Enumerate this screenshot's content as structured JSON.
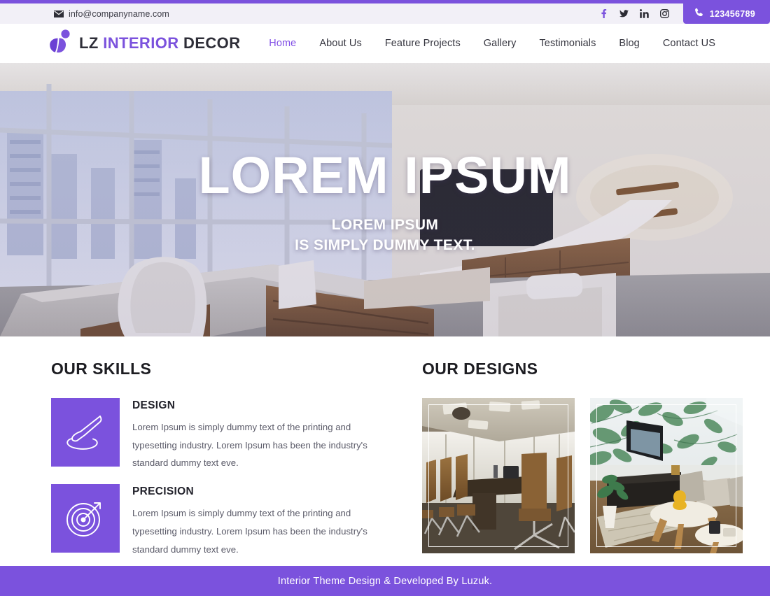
{
  "theme": {
    "accent": "#7b52dd",
    "accent_light": "#8250e6",
    "topbar_bg": "#f2f0f7",
    "dark_text": "#2e2e38"
  },
  "topbar": {
    "email": "info@companyname.com",
    "email_icon": "mail-icon",
    "socials": [
      {
        "name": "facebook-icon",
        "label": "f",
        "color": "#7b52dd"
      },
      {
        "name": "twitter-icon",
        "label": "t",
        "color": "#2b2b33"
      },
      {
        "name": "linkedin-icon",
        "label": "in",
        "color": "#2b2b33"
      },
      {
        "name": "instagram-icon",
        "label": "ig",
        "color": "#2b2b33"
      }
    ],
    "phone_icon": "phone-icon",
    "phone": "123456789"
  },
  "header": {
    "logo_icon": "leaf-person-logo-icon",
    "brand_part1": "LZ ",
    "brand_part2": "INTERIOR",
    "brand_part3": " DECOR",
    "nav": [
      {
        "label": "Home",
        "active": true
      },
      {
        "label": "About Us",
        "active": false
      },
      {
        "label": "Feature Projects",
        "active": false
      },
      {
        "label": "Gallery",
        "active": false
      },
      {
        "label": "Testimonials",
        "active": false
      },
      {
        "label": "Blog",
        "active": false
      },
      {
        "label": "Contact US",
        "active": false
      }
    ]
  },
  "hero": {
    "title": "LOREM IPSUM",
    "subtitle_line1": "LOREM IPSUM",
    "subtitle_line2": "IS SIMPLY DUMMY TEXT.",
    "image_alt": "modern office interior with desk, chairs and city window view"
  },
  "skills": {
    "title": "OUR SKILLS",
    "items": [
      {
        "icon": "paintbrush-icon",
        "title": "DESIGN",
        "text": "Lorem Ipsum is simply dummy text of the printing and typesetting industry. Lorem Ipsum has been the industry's standard dummy text eve."
      },
      {
        "icon": "target-arrow-icon",
        "title": "PRECISION",
        "text": "Lorem Ipsum is simply dummy text of the printing and typesetting industry. Lorem Ipsum has been the industry's standard dummy text eve."
      }
    ]
  },
  "designs": {
    "title": "OUR DESIGNS",
    "items": [
      {
        "alt": "conference room with brown leather chairs and long table"
      },
      {
        "alt": "lounge with botanical wallpaper, tv, dark sofa and wooden tables"
      }
    ]
  },
  "footer": {
    "text": "Interior Theme Design & Developed By Luzuk."
  }
}
